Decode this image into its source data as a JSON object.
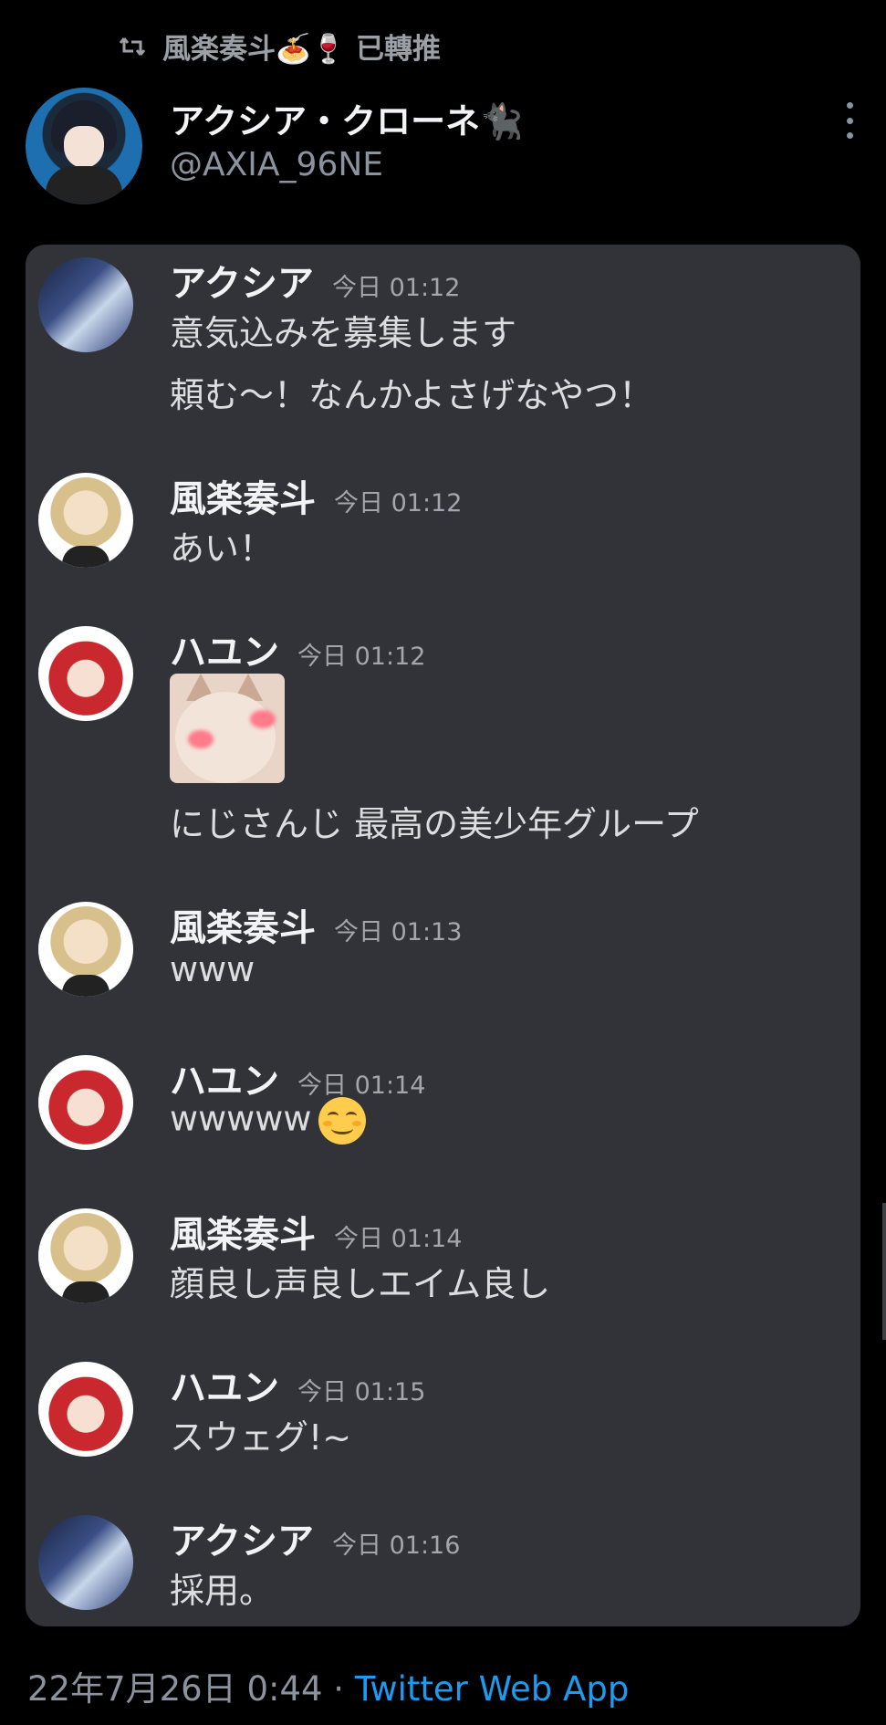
{
  "retweet": {
    "text": "風楽奏斗🍝🍷 已轉推"
  },
  "author": {
    "display_name": "アクシア・クローネ🐈‍⬛",
    "handle": "@AXIA_96NE"
  },
  "messages": [
    {
      "user": "アクシア",
      "time": "今日 01:12",
      "lines": [
        "意気込みを募集します",
        "頼む～！なんかよさげなやつ！"
      ]
    },
    {
      "user": "風楽奏斗",
      "time": "今日 01:12",
      "lines": [
        "あい！"
      ]
    },
    {
      "user": "ハユン",
      "time": "今日 01:12",
      "lines": [
        "にじさんじ 最高の美少年グループ"
      ]
    },
    {
      "user": "風楽奏斗",
      "time": "今日 01:13",
      "lines": [
        "www"
      ]
    },
    {
      "user": "ハユン",
      "time": "今日 01:14",
      "lines": [
        "wwwww"
      ]
    },
    {
      "user": "風楽奏斗",
      "time": "今日 01:14",
      "lines": [
        "顔良し声良しエイム良し"
      ]
    },
    {
      "user": "ハユン",
      "time": "今日 01:15",
      "lines": [
        "スウェグ!~"
      ]
    },
    {
      "user": "アクシア",
      "time": "今日 01:16",
      "lines": [
        "採用。"
      ]
    }
  ],
  "footer": {
    "date": "22年7月26日 0:44 · ",
    "source": "Twitter Web App"
  }
}
